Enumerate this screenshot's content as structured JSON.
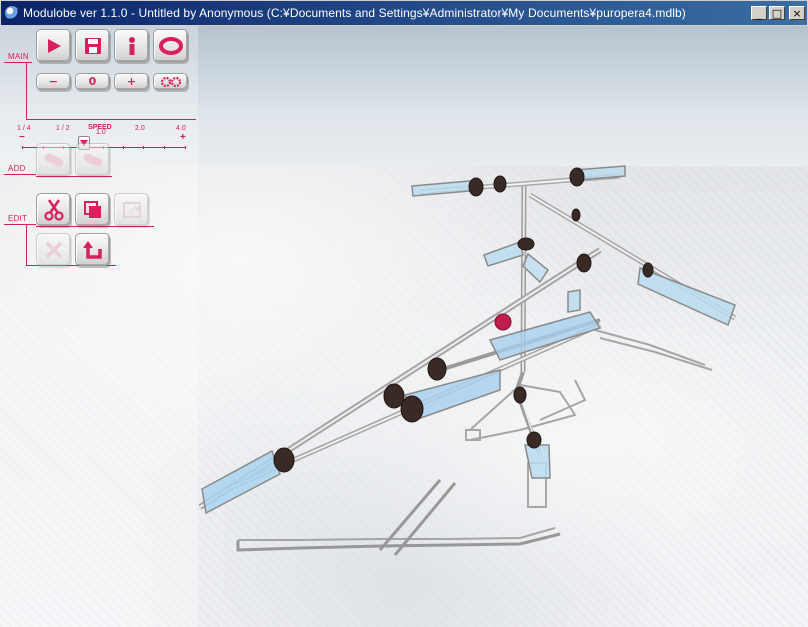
{
  "window": {
    "title": "Modulobe ver 1.1.0 - Untitled by Anonymous (C:¥Documents and Settings¥Administrator¥My Documents¥puropera4.mdlb)",
    "minimize_glyph": "_",
    "maximize_glyph": "□",
    "close_glyph": "×"
  },
  "panel": {
    "sections": {
      "main": "MAIN",
      "add": "ADD",
      "edit": "EDIT"
    },
    "main": {
      "zoom_minus": "−",
      "zoom_value": "0",
      "zoom_plus": "+"
    },
    "speed": {
      "label": "SPEED",
      "minus_sign": "−",
      "plus_sign": "+",
      "ticks": [
        "1 / 4",
        "1 / 2",
        "1.0",
        "2.0",
        "4.0"
      ],
      "current": "1.0"
    }
  },
  "colors": {
    "accent": "#d0205a",
    "titlebar": "#0a246a"
  }
}
